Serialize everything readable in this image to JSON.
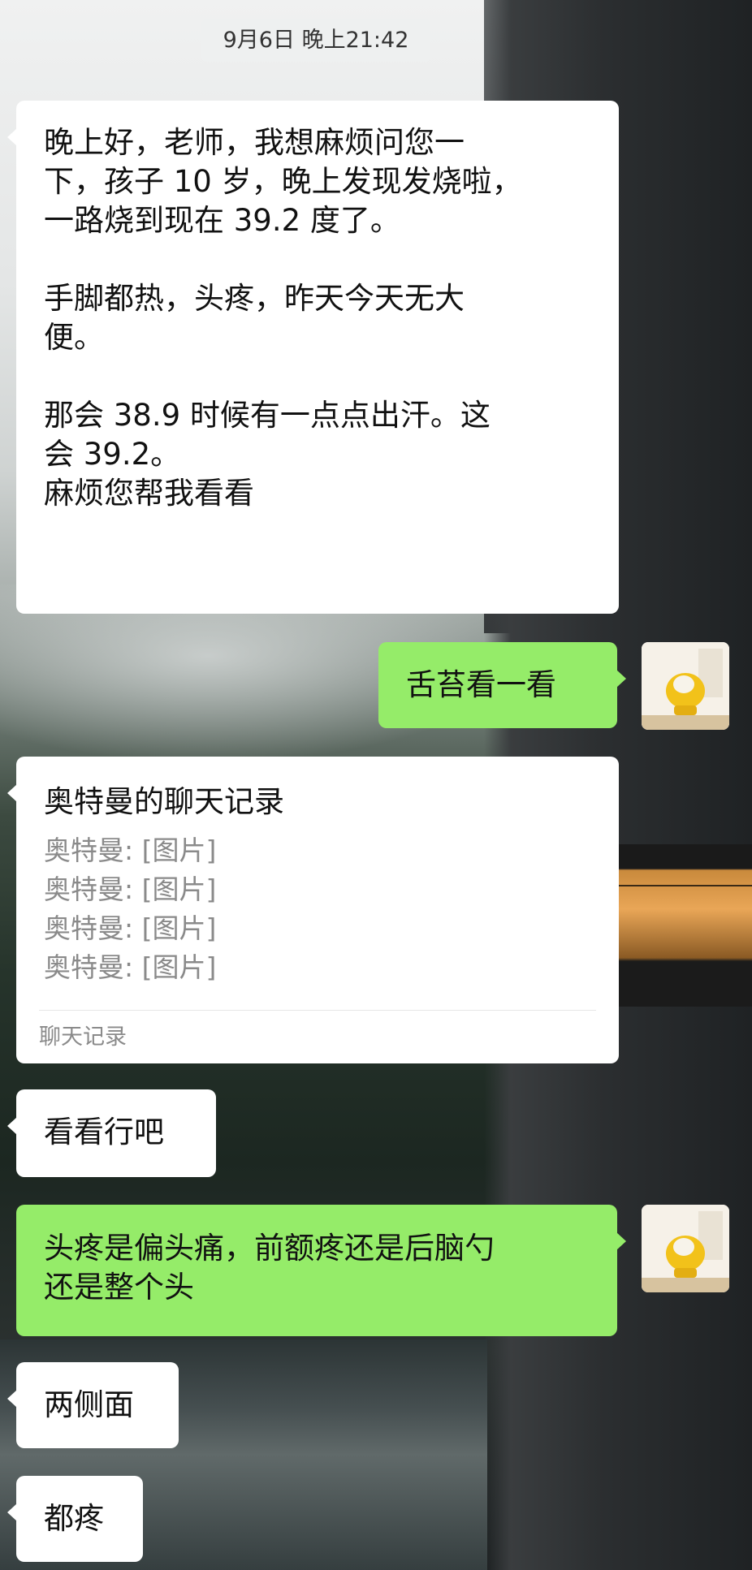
{
  "timestamp": "9月6日 晚上21:42",
  "messages": [
    {
      "side": "left",
      "paragraphs": [
        "晚上好，老师，我想麻烦问您一\n下，孩子 10 岁，晚上发现发烧啦，\n一路烧到现在 39.2 度了。",
        "手脚都热，头疼，昨天今天无大\n便。",
        "那会 38.9 时候有一点点出汗。这\n会 39.2。\n麻烦您帮我看看"
      ]
    },
    {
      "side": "right",
      "text": "舌苔看一看"
    },
    {
      "side": "left",
      "type": "chat-record",
      "title": "奥特曼的聊天记录",
      "lines": [
        "奥特曼: [图片]",
        "奥特曼: [图片]",
        "奥特曼: [图片]",
        "奥特曼: [图片]"
      ],
      "footer": "聊天记录"
    },
    {
      "side": "left",
      "text": "看看行吧"
    },
    {
      "side": "right",
      "text": "头疼是偏头痛，前额疼还是后脑勺\n还是整个头"
    },
    {
      "side": "left",
      "text": "两侧面"
    },
    {
      "side": "left",
      "text": "都疼"
    }
  ],
  "colors": {
    "sent_bubble": "#95ec69",
    "received_bubble": "#ffffff"
  },
  "icons": {
    "avatar": "yellow-chair-avatar-icon"
  }
}
